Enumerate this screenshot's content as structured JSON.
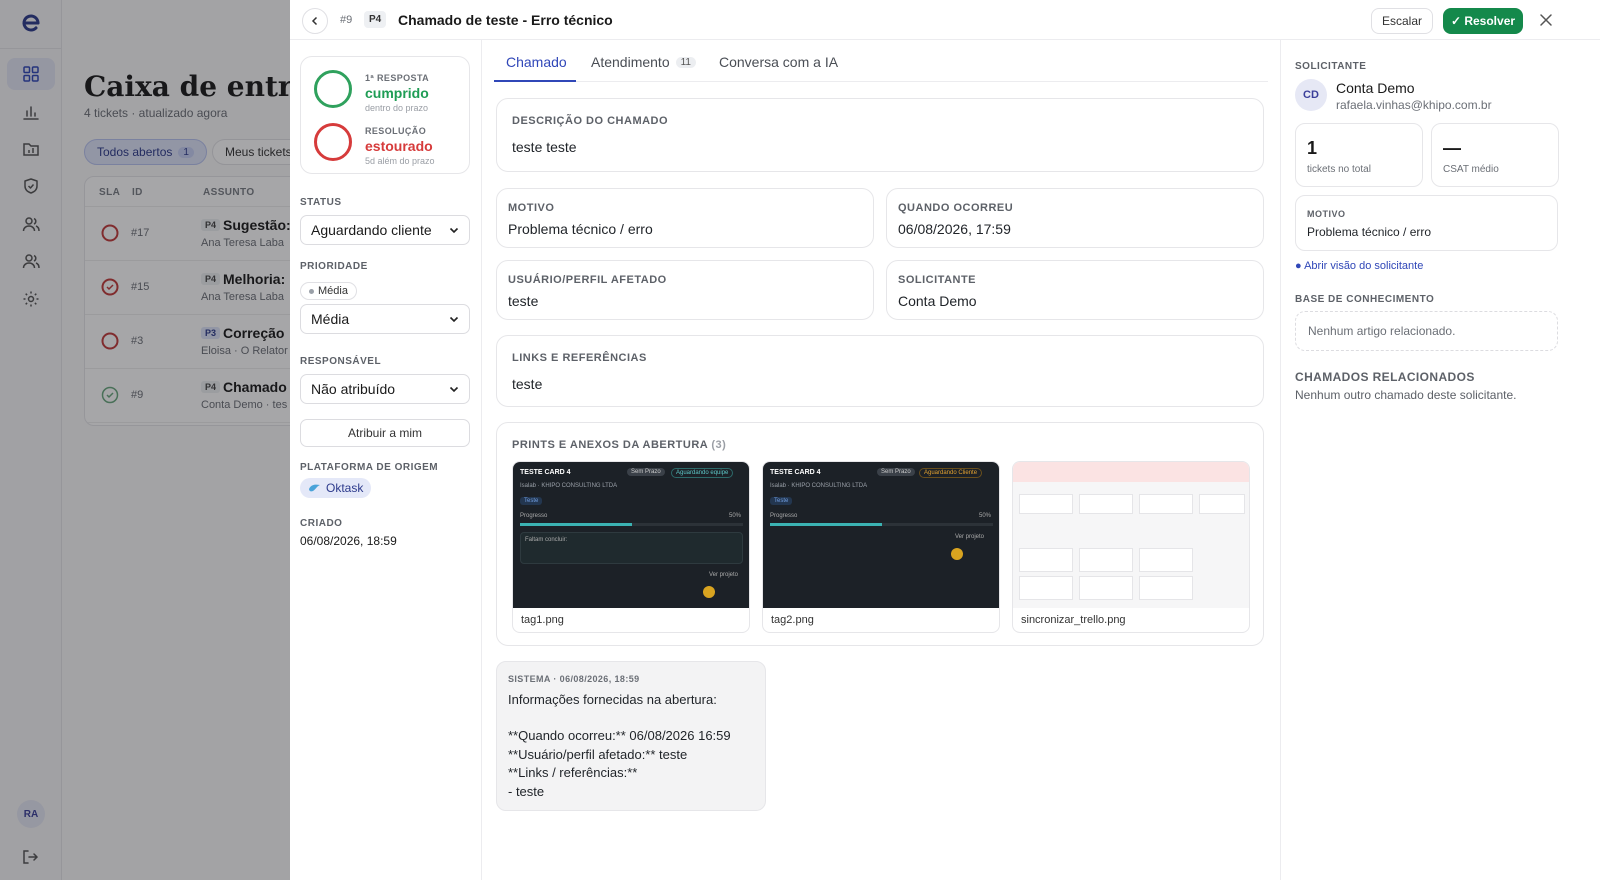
{
  "rail": {
    "avatar": "RA"
  },
  "inbox": {
    "title": "Caixa de entrada",
    "subtitle": "4 tickets · atualizado agora",
    "filters": [
      {
        "label": "Todos abertos",
        "count": "1"
      },
      {
        "label": "Meus tickets"
      }
    ],
    "columns": {
      "sla": "SLA",
      "id": "ID",
      "subject": "ASSUNTO"
    },
    "rows": [
      {
        "id": "#17",
        "prio": "P4",
        "subject": "Sugestão:",
        "who": "Ana Teresa Laba"
      },
      {
        "id": "#15",
        "prio": "P4",
        "subject": "Melhoria:",
        "who": "Ana Teresa Laba"
      },
      {
        "id": "#3",
        "prio": "P3",
        "subject": "Correção",
        "who": "Eloisa · O Relator"
      },
      {
        "id": "#9",
        "prio": "P4",
        "subject": "Chamado",
        "who": "Conta Demo · tes"
      }
    ]
  },
  "header": {
    "ticket_id": "#9",
    "priority": "P4",
    "title": "Chamado de teste - Erro técnico",
    "escalar": "Escalar",
    "resolver": "✓ Resolver"
  },
  "sla": {
    "first": {
      "label": "1ª RESPOSTA",
      "value": "cumprido",
      "note": "dentro do prazo"
    },
    "resolution": {
      "label": "RESOLUÇÃO",
      "value": "estourado",
      "note": "5d além do prazo"
    }
  },
  "left": {
    "status_label": "STATUS",
    "status_value": "Aguardando cliente",
    "priority_label": "PRIORIDADE",
    "priority_chip": "Média",
    "priority_value": "Média",
    "responsible_label": "RESPONSÁVEL",
    "responsible_value": "Não atribuído",
    "assign_button": "Atribuir a mim",
    "platform_label": "PLATAFORMA DE ORIGEM",
    "platform_value": "Oktask",
    "created_label": "CRIADO",
    "created_value": "06/08/2026, 18:59"
  },
  "tabs": [
    {
      "label": "Chamado"
    },
    {
      "label": "Atendimento",
      "badge": "11"
    },
    {
      "label": "Conversa com a IA"
    }
  ],
  "ticket": {
    "description_label": "DESCRIÇÃO DO CHAMADO",
    "description": "teste teste",
    "motivo_label": "MOTIVO",
    "motivo": "Problema técnico / erro",
    "when_label": "QUANDO OCORREU",
    "when": "06/08/2026, 17:59",
    "affected_label": "USUÁRIO/PERFIL AFETADO",
    "affected": "teste",
    "requester_label": "SOLICITANTE",
    "requester": "Conta Demo",
    "links_label": "LINKS E REFERÊNCIAS",
    "links": "teste",
    "attachments_label": "PRINTS E ANEXOS DA ABERTURA",
    "attachments_count": "(3)",
    "attachments": [
      {
        "file": "tag1.png",
        "card": "TESTE CARD 4",
        "status": "Aguardando equipe",
        "deadline": "Sem Prazo",
        "org": "Isalab · KHIPO CONSULTING LTDA",
        "progress_label": "Progresso",
        "progress": "50%",
        "tag": "Teste",
        "extra": "Faltam concluir:",
        "link": "Ver projeto"
      },
      {
        "file": "tag2.png",
        "card": "TESTE CARD 4",
        "status": "Aguardando Cliente",
        "deadline": "Sem Prazo",
        "org": "Isalab · KHIPO CONSULTING LTDA",
        "progress_label": "Progresso",
        "progress": "50%",
        "tag": "Teste",
        "link": "Ver projeto"
      },
      {
        "file": "sincronizar_trello.png"
      }
    ]
  },
  "message": {
    "header": "SISTEMA · 06/08/2026, 18:59",
    "lines": [
      "Informações fornecidas na abertura:",
      "",
      "**Quando ocorreu:** 06/08/2026 16:59",
      "**Usuário/perfil afetado:** teste",
      "**Links / referências:**",
      "- teste"
    ]
  },
  "right": {
    "section_requester": "SOLICITANTE",
    "avatar": "CD",
    "name": "Conta Demo",
    "email": "rafaela.vinhas@khipo.com.br",
    "stat1_num": "1",
    "stat1_label": "tickets no total",
    "stat2_num": "—",
    "stat2_label": "CSAT médio",
    "motivo_label": "MOTIVO",
    "motivo": "Problema técnico / erro",
    "open_link": "● Abrir visão do solicitante",
    "kb_label": "BASE DE CONHECIMENTO",
    "kb_empty": "Nenhum artigo relacionado.",
    "related_label": "CHAMADOS RELACIONADOS",
    "related_empty": "Nenhum outro chamado deste solicitante."
  },
  "colors": {
    "accent": "#3047b8",
    "success": "#1f9d55",
    "danger": "#d63b3b",
    "resolver": "#14894b"
  }
}
